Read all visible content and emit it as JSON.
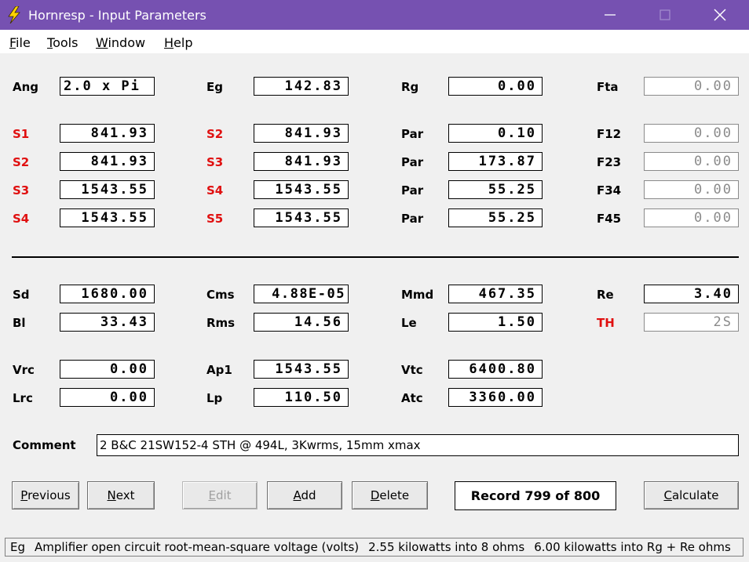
{
  "window": {
    "title": "Hornresp - Input Parameters",
    "icon": "lightning-bolt-icon",
    "accent": "#7651b1"
  },
  "menu": [
    {
      "first": "F",
      "rest": "ile"
    },
    {
      "first": "T",
      "rest": "ools"
    },
    {
      "first": "W",
      "rest": "indow"
    },
    {
      "first": "H",
      "rest": "elp"
    }
  ],
  "top": {
    "ang": {
      "label": "Ang",
      "value": "2.0 x Pi"
    },
    "eg": {
      "label": "Eg",
      "value": "142.83"
    },
    "rg": {
      "label": "Rg",
      "value": "0.00"
    },
    "fta": {
      "label": "Fta",
      "value": "0.00"
    }
  },
  "rows": [
    {
      "l1": "S1",
      "v1": "841.93",
      "l2": "S2",
      "v2": "841.93",
      "l3": "Par",
      "v3": "0.10",
      "l4": "F12",
      "v4": "0.00"
    },
    {
      "l1": "S2",
      "v1": "841.93",
      "l2": "S3",
      "v2": "841.93",
      "l3": "Par",
      "v3": "173.87",
      "l4": "F23",
      "v4": "0.00"
    },
    {
      "l1": "S3",
      "v1": "1543.55",
      "l2": "S4",
      "v2": "1543.55",
      "l3": "Par",
      "v3": "55.25",
      "l4": "F34",
      "v4": "0.00"
    },
    {
      "l1": "S4",
      "v1": "1543.55",
      "l2": "S5",
      "v2": "1543.55",
      "l3": "Par",
      "v3": "55.25",
      "l4": "F45",
      "v4": "0.00"
    }
  ],
  "driver": {
    "sd": {
      "label": "Sd",
      "value": "1680.00"
    },
    "cms": {
      "label": "Cms",
      "value": "4.88E-05"
    },
    "mmd": {
      "label": "Mmd",
      "value": "467.35"
    },
    "re": {
      "label": "Re",
      "value": "3.40"
    },
    "bl": {
      "label": "Bl",
      "value": "33.43"
    },
    "rms": {
      "label": "Rms",
      "value": "14.56"
    },
    "le": {
      "label": "Le",
      "value": "1.50"
    },
    "th": {
      "label": "TH",
      "value": "2S"
    }
  },
  "chamber": {
    "vrc": {
      "label": "Vrc",
      "value": "0.00"
    },
    "ap1": {
      "label": "Ap1",
      "value": "1543.55"
    },
    "vtc": {
      "label": "Vtc",
      "value": "6400.80"
    },
    "lrc": {
      "label": "Lrc",
      "value": "0.00"
    },
    "lp": {
      "label": "Lp",
      "value": "110.50"
    },
    "atc": {
      "label": "Atc",
      "value": "3360.00"
    }
  },
  "comment": {
    "label": "Comment",
    "value": "2 B&C 21SW152-4 STH @ 494L, 3Kwrms, 15mm xmax"
  },
  "buttons": {
    "previous": {
      "first": "P",
      "rest": "revious"
    },
    "next": {
      "first": "N",
      "rest": "ext"
    },
    "edit": {
      "first": "E",
      "rest": "dit"
    },
    "add": {
      "first": "A",
      "rest": "dd"
    },
    "delete": {
      "first": "D",
      "rest": "elete"
    },
    "calculate": {
      "first": "C",
      "rest": "alculate"
    }
  },
  "record": "Record 799 of 800",
  "status": {
    "param": "Eg",
    "description": "Amplifier open circuit root-mean-square voltage  (volts)",
    "power1": "2.55 kilowatts into 8 ohms",
    "power2": "6.00 kilowatts into Rg + Re ohms"
  }
}
